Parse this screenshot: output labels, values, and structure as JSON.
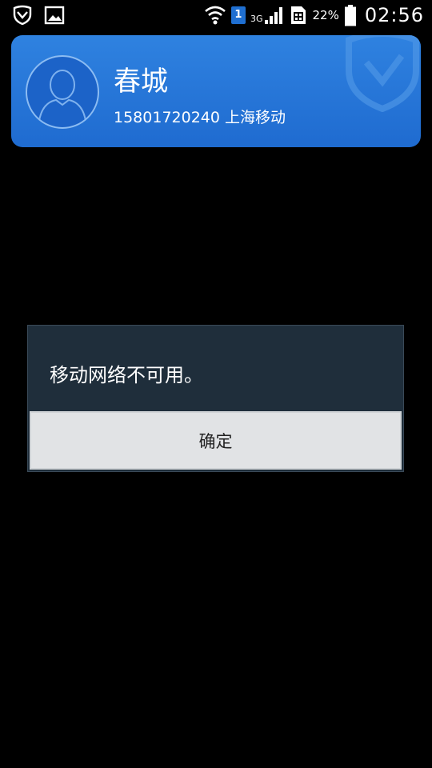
{
  "status_bar": {
    "left_icons": [
      "shield-icon",
      "image-icon"
    ],
    "sim_slot": "1",
    "network_type": "3G",
    "battery_percent": "22%",
    "time": "02:56"
  },
  "profile": {
    "name": "春城",
    "phone_carrier": "15801720240 上海移动",
    "accent_color": "#2f82e0"
  },
  "dialog": {
    "message": "移动网络不可用。",
    "confirm_label": "确定"
  }
}
